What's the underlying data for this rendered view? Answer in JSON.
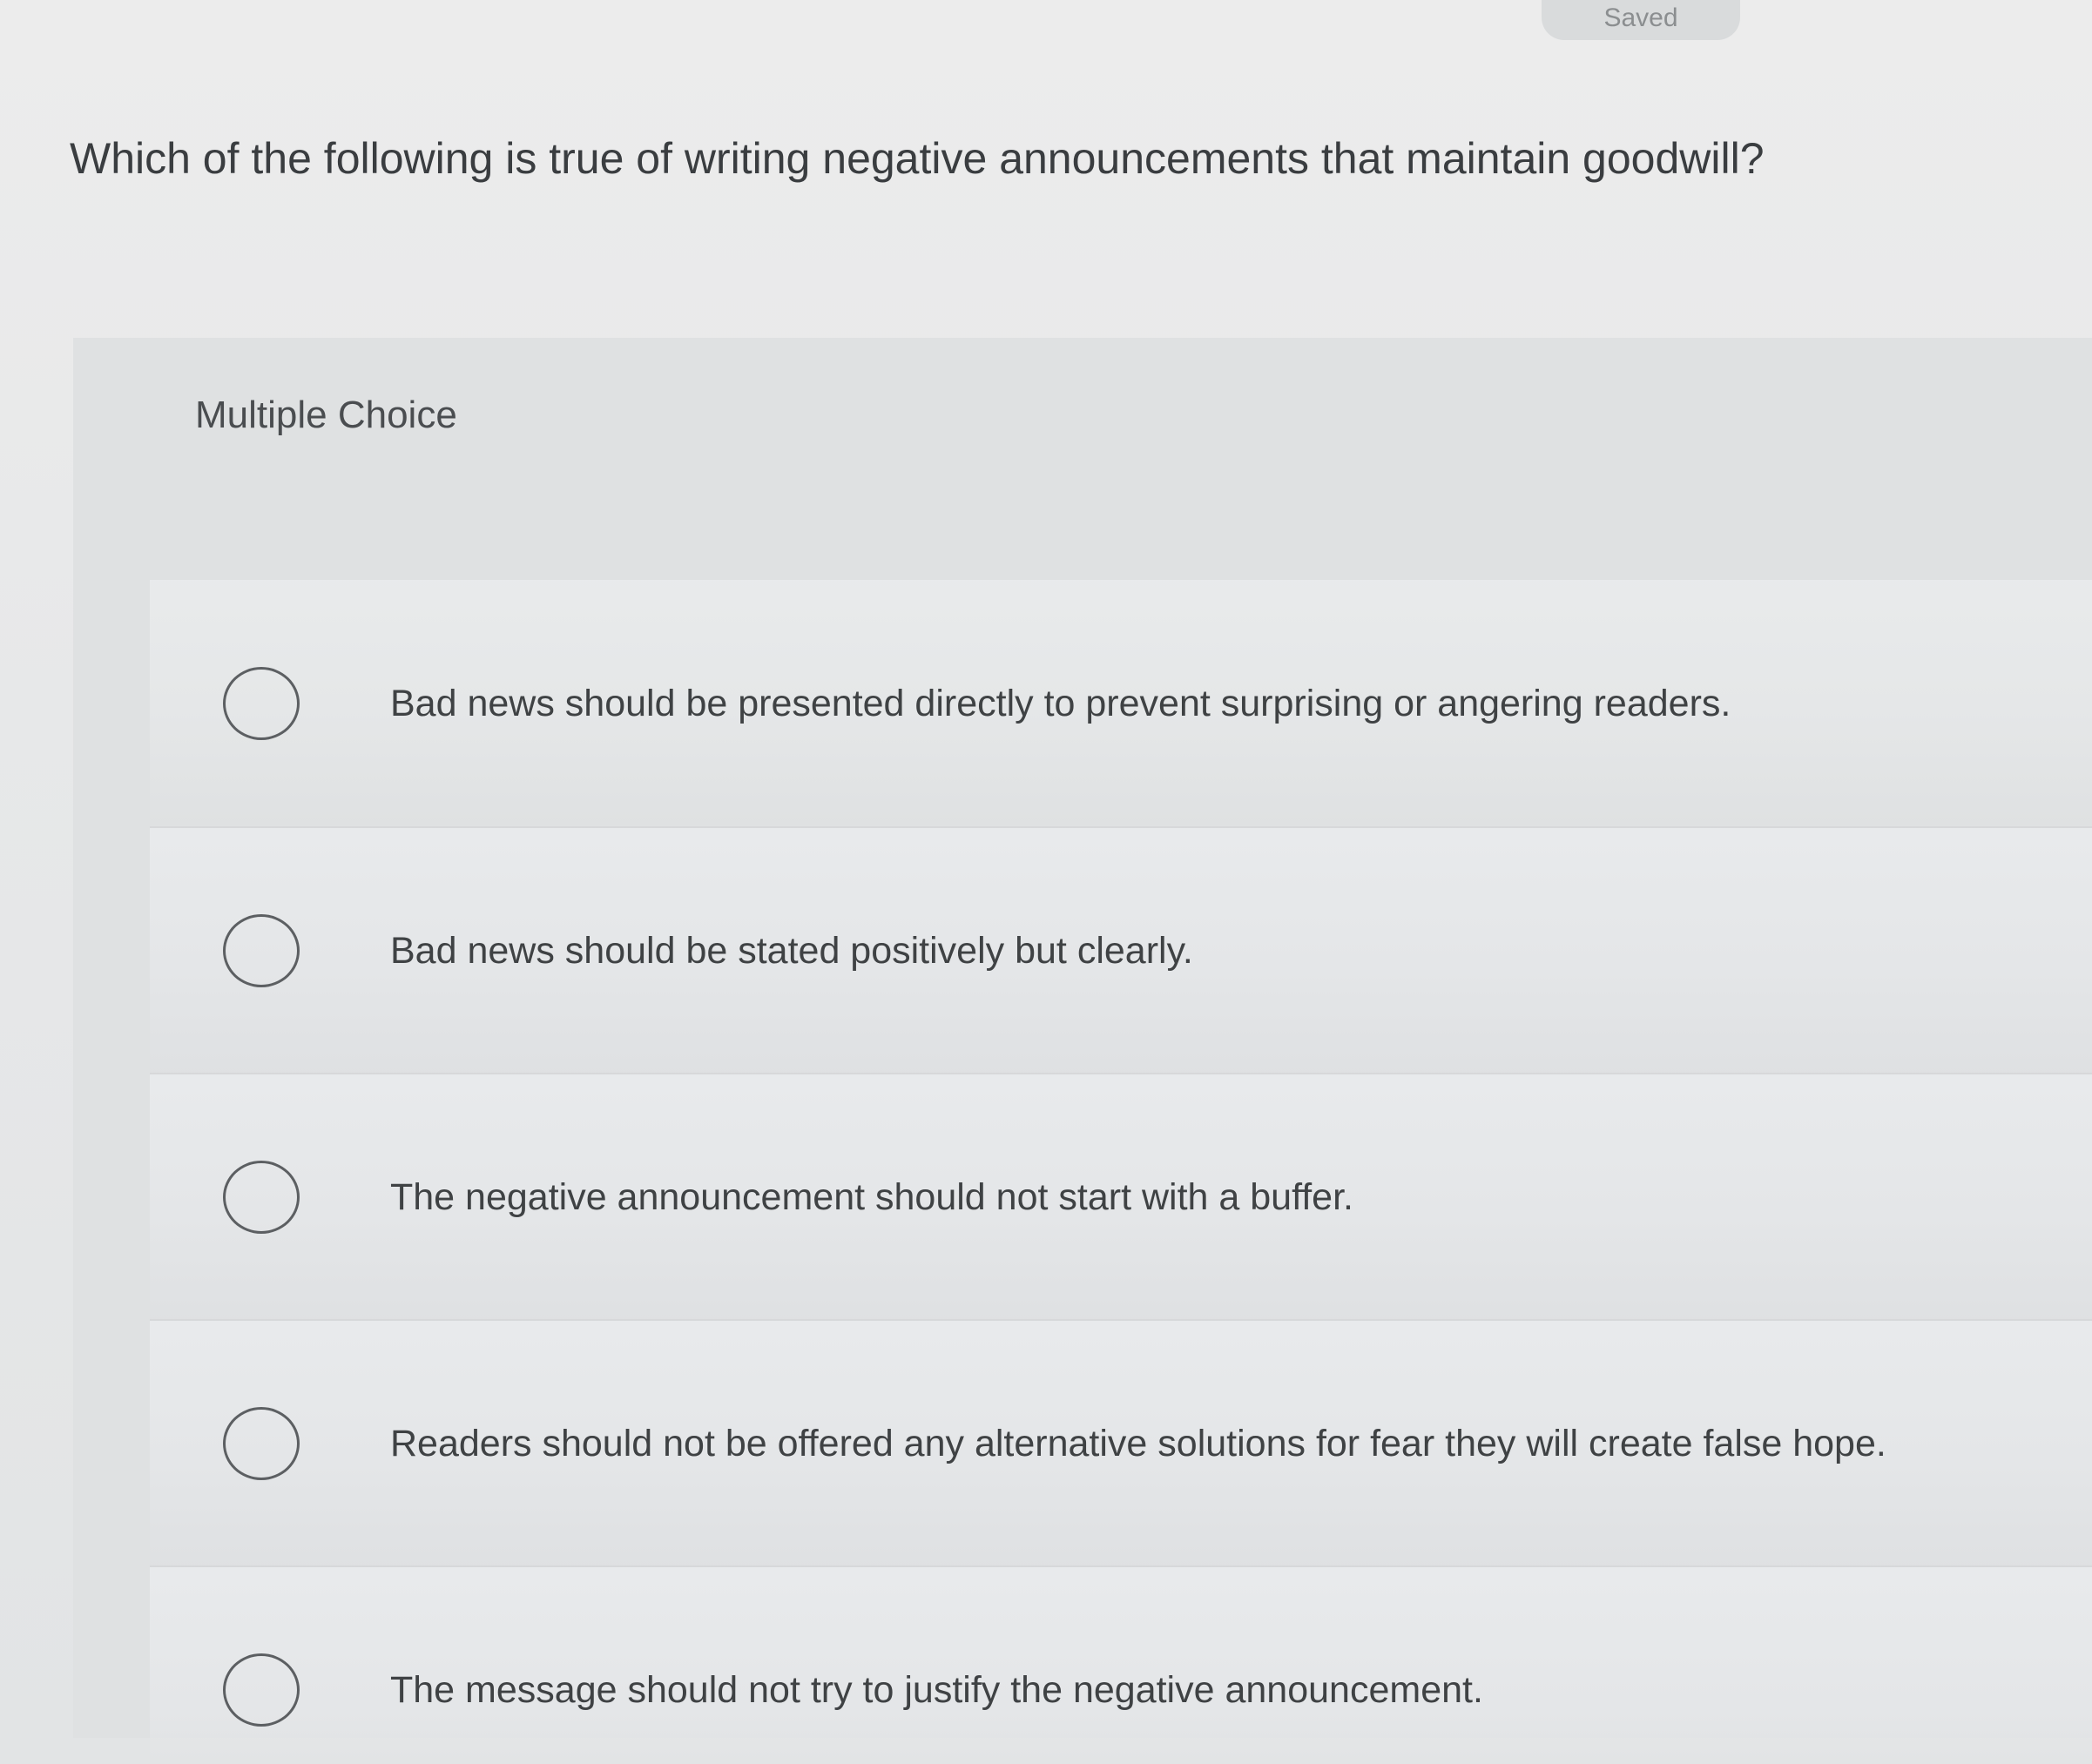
{
  "status": {
    "saved_label": "Saved"
  },
  "question": {
    "text": "Which of the following is true of writing negative announcements that maintain goodwill?"
  },
  "choice_panel": {
    "type_label": "Multiple Choice",
    "options": [
      {
        "label": "Bad news should be presented directly to prevent surprising or angering readers."
      },
      {
        "label": "Bad news should be stated positively but clearly."
      },
      {
        "label": "The negative announcement should not start with a buffer."
      },
      {
        "label": "Readers should not be offered any alternative solutions for fear they will create false hope."
      },
      {
        "label": "The message should not try to justify the negative announcement."
      }
    ]
  }
}
